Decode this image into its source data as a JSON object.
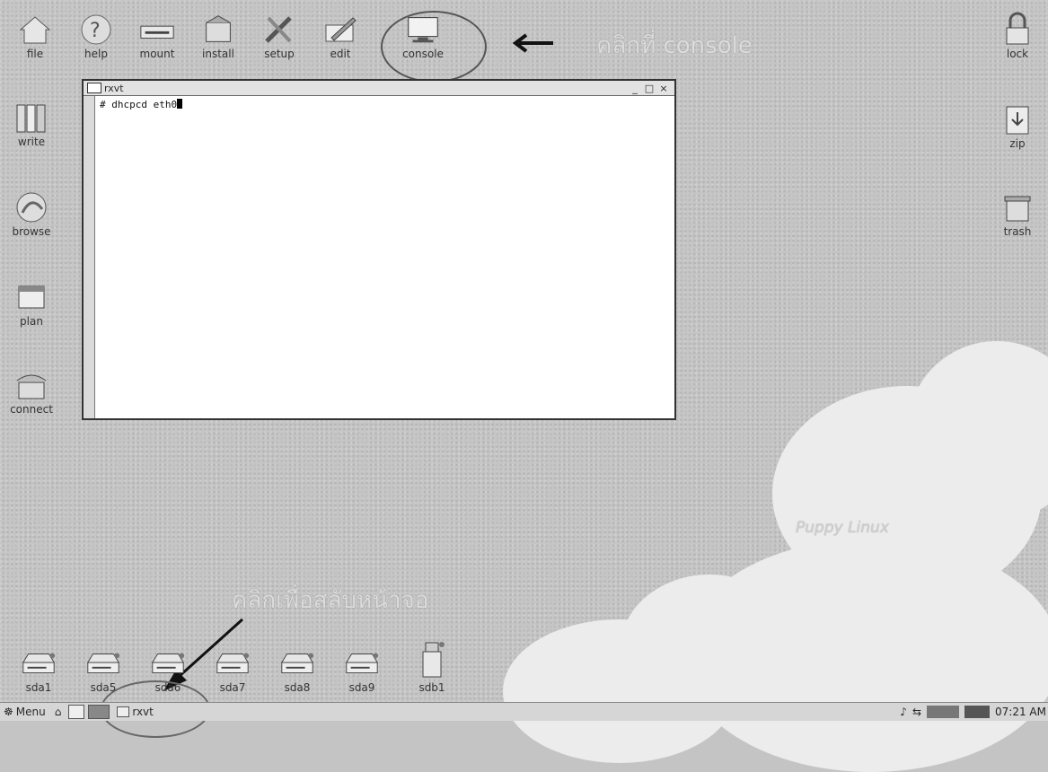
{
  "top_icons": [
    {
      "name": "file",
      "label": "file"
    },
    {
      "name": "help",
      "label": "help"
    },
    {
      "name": "mount",
      "label": "mount"
    },
    {
      "name": "install",
      "label": "install"
    },
    {
      "name": "setup",
      "label": "setup"
    },
    {
      "name": "edit",
      "label": "edit"
    },
    {
      "name": "console",
      "label": "console"
    }
  ],
  "left_icons": [
    {
      "name": "write",
      "label": "write"
    },
    {
      "name": "browse",
      "label": "browse"
    },
    {
      "name": "plan",
      "label": "plan"
    },
    {
      "name": "connect",
      "label": "connect"
    }
  ],
  "right_icons": [
    {
      "name": "lock",
      "label": "lock"
    },
    {
      "name": "zip",
      "label": "zip"
    },
    {
      "name": "trash",
      "label": "trash"
    }
  ],
  "drive_icons": [
    {
      "name": "sda1",
      "label": "sda1"
    },
    {
      "name": "sda5",
      "label": "sda5"
    },
    {
      "name": "sda6",
      "label": "sda6"
    },
    {
      "name": "sda7",
      "label": "sda7"
    },
    {
      "name": "sda8",
      "label": "sda8"
    },
    {
      "name": "sda9",
      "label": "sda9"
    },
    {
      "name": "sdb1",
      "label": "sdb1"
    }
  ],
  "window": {
    "title": "rxvt",
    "command": "# dhcpcd eth0",
    "ctrl_min": "_",
    "ctrl_max": "□",
    "ctrl_close": "×"
  },
  "annotations": {
    "top_text": "คลิกที่ console",
    "bottom_text": "คลิกเพื่อสลับหน้าจอ"
  },
  "watermark": "Puppy Linux",
  "taskbar": {
    "menu_label": "Menu",
    "task_label": "rxvt",
    "clock": "07:21 AM"
  }
}
